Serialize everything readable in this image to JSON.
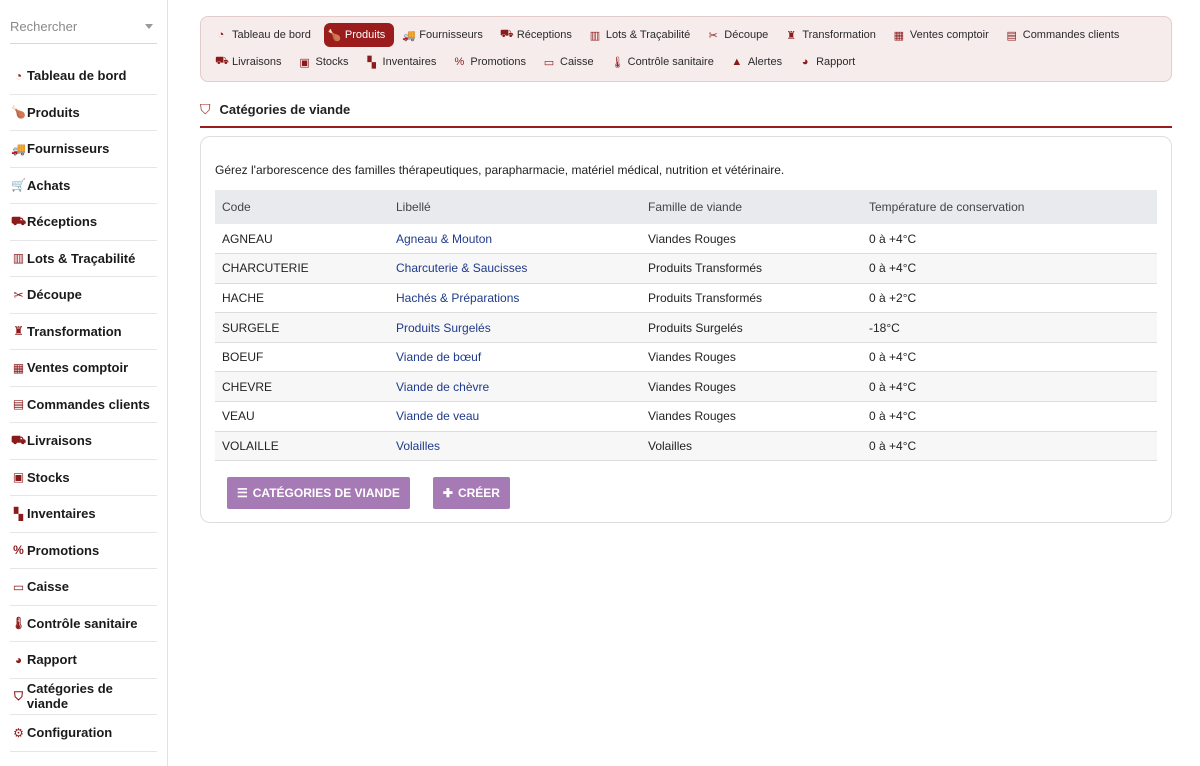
{
  "search": {
    "placeholder": "Rechercher"
  },
  "sidebar": {
    "items": [
      {
        "label": "Tableau de bord",
        "icon": "gauge-icon",
        "glyph": "◔"
      },
      {
        "label": "Produits",
        "icon": "drumstick-icon",
        "glyph": "🍗"
      },
      {
        "label": "Fournisseurs",
        "icon": "truck-icon",
        "glyph": "🚚"
      },
      {
        "label": "Achats",
        "icon": "cart-icon",
        "glyph": "🛒"
      },
      {
        "label": "Réceptions",
        "icon": "dolly-icon",
        "glyph": "⛟"
      },
      {
        "label": "Lots & Traçabilité",
        "icon": "barcode-icon",
        "glyph": "▥"
      },
      {
        "label": "Découpe",
        "icon": "scissors-icon",
        "glyph": "✂"
      },
      {
        "label": "Transformation",
        "icon": "blender-icon",
        "glyph": "♜"
      },
      {
        "label": "Ventes comptoir",
        "icon": "cash-register-icon",
        "glyph": "▦"
      },
      {
        "label": "Commandes clients",
        "icon": "clipboard-icon",
        "glyph": "▤"
      },
      {
        "label": "Livraisons",
        "icon": "shipping-icon",
        "glyph": "⛟"
      },
      {
        "label": "Stocks",
        "icon": "warehouse-icon",
        "glyph": "▣"
      },
      {
        "label": "Inventaires",
        "icon": "boxes-icon",
        "glyph": "▚"
      },
      {
        "label": "Promotions",
        "icon": "percent-icon",
        "glyph": "%"
      },
      {
        "label": "Caisse",
        "icon": "money-icon",
        "glyph": "▭"
      },
      {
        "label": "Contrôle sanitaire",
        "icon": "thermometer-icon",
        "glyph": "🌡"
      },
      {
        "label": "Rapport",
        "icon": "pie-chart-icon",
        "glyph": "◕"
      },
      {
        "label": "Catégories de viande",
        "icon": "tags-icon",
        "glyph": "⛉"
      },
      {
        "label": "Configuration",
        "icon": "gear-icon",
        "glyph": "⚙"
      }
    ]
  },
  "topnav": {
    "items": [
      {
        "label": "Tableau de bord",
        "icon": "gauge-icon",
        "glyph": "◔",
        "active": false
      },
      {
        "label": "Produits",
        "icon": "drumstick-icon",
        "glyph": "🍗",
        "active": true
      },
      {
        "label": "Fournisseurs",
        "icon": "truck-icon",
        "glyph": "🚚",
        "active": false
      },
      {
        "label": "Réceptions",
        "icon": "dolly-icon",
        "glyph": "⛟",
        "active": false
      },
      {
        "label": "Lots & Traçabilité",
        "icon": "barcode-icon",
        "glyph": "▥",
        "active": false
      },
      {
        "label": "Découpe",
        "icon": "scissors-icon",
        "glyph": "✂",
        "active": false
      },
      {
        "label": "Transformation",
        "icon": "blender-icon",
        "glyph": "♜",
        "active": false
      },
      {
        "label": "Ventes comptoir",
        "icon": "cash-register-icon",
        "glyph": "▦",
        "active": false
      },
      {
        "label": "Commandes clients",
        "icon": "clipboard-icon",
        "glyph": "▤",
        "active": false
      },
      {
        "label": "Livraisons",
        "icon": "shipping-icon",
        "glyph": "⛟",
        "active": false
      },
      {
        "label": "Stocks",
        "icon": "warehouse-icon",
        "glyph": "▣",
        "active": false
      },
      {
        "label": "Inventaires",
        "icon": "boxes-icon",
        "glyph": "▚",
        "active": false
      },
      {
        "label": "Promotions",
        "icon": "percent-icon",
        "glyph": "%",
        "active": false
      },
      {
        "label": "Caisse",
        "icon": "money-icon",
        "glyph": "▭",
        "active": false
      },
      {
        "label": "Contrôle sanitaire",
        "icon": "thermometer-icon",
        "glyph": "🌡",
        "active": false
      },
      {
        "label": "Alertes",
        "icon": "warning-icon",
        "glyph": "▲",
        "active": false
      },
      {
        "label": "Rapport",
        "icon": "pie-chart-icon",
        "glyph": "◕",
        "active": false
      }
    ]
  },
  "page": {
    "title": "Catégories de viande",
    "title_icon": "tags-icon",
    "description": "Gérez l'arborescence des familles thérapeutiques, parapharmacie, matériel médical, nutrition et vétérinaire."
  },
  "table": {
    "columns": [
      "Code",
      "Libellé",
      "Famille de viande",
      "Température de conservation"
    ],
    "rows": [
      [
        "AGNEAU",
        "Agneau & Mouton",
        "Viandes Rouges",
        "0 à +4°C"
      ],
      [
        "CHARCUTERIE",
        "Charcuterie & Saucisses",
        "Produits Transformés",
        "0 à +4°C"
      ],
      [
        "HACHE",
        "Hachés & Préparations",
        "Produits Transformés",
        "0 à +2°C"
      ],
      [
        "SURGELE",
        "Produits Surgelés",
        "Produits Surgelés",
        "-18°C"
      ],
      [
        "BOEUF",
        "Viande de bœuf",
        "Viandes Rouges",
        "0 à +4°C"
      ],
      [
        "CHEVRE",
        "Viande de chèvre",
        "Viandes Rouges",
        "0 à +4°C"
      ],
      [
        "VEAU",
        "Viande de veau",
        "Viandes Rouges",
        "0 à +4°C"
      ],
      [
        "VOLAILLE",
        "Volailles",
        "Volailles",
        "0 à +4°C"
      ]
    ]
  },
  "actions": {
    "list_label": "CATÉGORIES DE VIANDE",
    "list_icon": "list-icon",
    "create_label": "CRÉER",
    "create_icon": "plus-icon"
  },
  "colors": {
    "accent": "#9b1c1c",
    "button": "#a67bb5",
    "link": "#1f3a8a"
  }
}
